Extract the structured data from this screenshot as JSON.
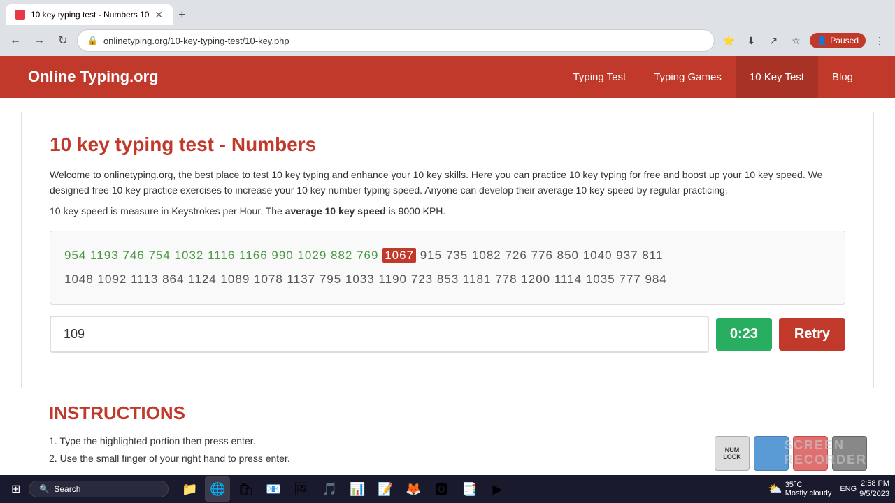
{
  "browser": {
    "tab_title": "10 key typing test - Numbers 10",
    "url": "onlinetyping.org/10-key-typing-test/10-key.php",
    "new_tab_icon": "+",
    "back_icon": "←",
    "forward_icon": "→",
    "refresh_icon": "↻",
    "profile_label": "Paused"
  },
  "nav": {
    "logo": "Online Typing.org",
    "links": [
      {
        "label": "Typing Test",
        "active": false
      },
      {
        "label": "Typing Games",
        "active": false
      },
      {
        "label": "10 Key Test",
        "active": true
      },
      {
        "label": "Blog",
        "active": false
      }
    ]
  },
  "main": {
    "page_title": "10 key typing test - Numbers",
    "description": "Welcome to onlinetyping.org, the best place to test 10 key typing and enhance your 10 key skills. Here you can practice 10 key typing for free and boost up your 10 key speed. We designed free 10 key practice exercises to increase your 10 key number typing speed. Anyone can develop their average 10 key speed by regular practicing.",
    "avg_speed_prefix": "10 key speed is measure in Keystrokes per Hour. The ",
    "avg_speed_bold": "average 10 key speed",
    "avg_speed_suffix": " is 9000 KPH.",
    "typing_line1_typed": "954 1193 746 754 1032 1116 1166 990 1029 882 769 ",
    "typing_line1_current": "1067",
    "typing_line1_upcoming": " 915 735 1082 726 776 850 1040 937 811",
    "typing_line2": "1048 1092 1113 864 1124 1089 1078 1137 795 1033 1190 723 853 1181 778 1200 1114 1035 777 984",
    "input_value": "109",
    "input_placeholder": "",
    "timer_value": "0:23",
    "retry_label": "Retry"
  },
  "instructions": {
    "title": "INSTRUCTIONS",
    "lines": [
      "1. Type the highlighted portion then press enter.",
      "2. Use the small finger of your right hand to press enter."
    ]
  },
  "taskbar": {
    "search_placeholder": "Search",
    "weather_temp": "35°C",
    "weather_desc": "Mostly cloudy",
    "time": "2:58 PM",
    "date": "9/5/2023",
    "sys_icons": [
      "ENG"
    ],
    "apps": [
      "🗂",
      "🔍",
      "📁",
      "🌐",
      "🎵",
      "📧",
      "📊",
      "📝",
      "🖥",
      "🎮",
      "💼",
      "📰"
    ]
  }
}
